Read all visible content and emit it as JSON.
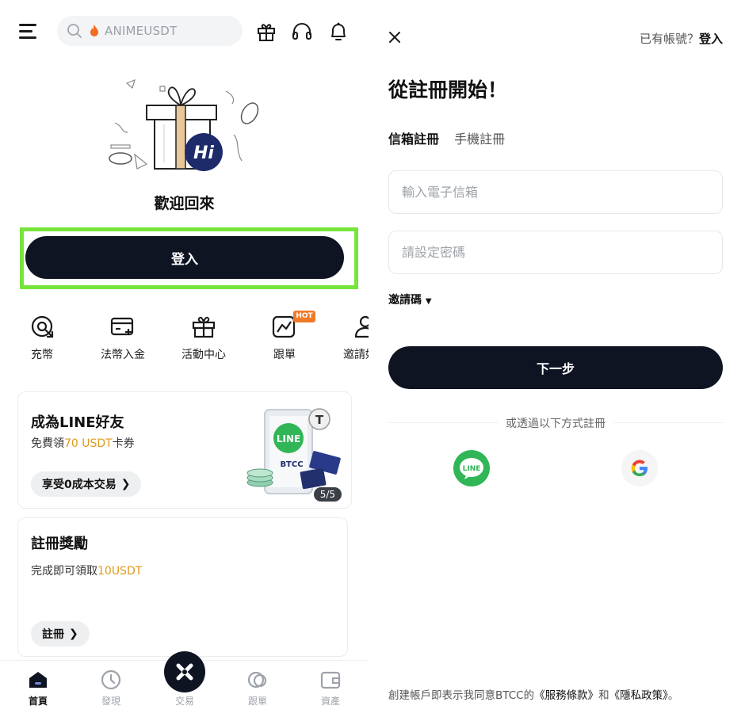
{
  "home": {
    "search": {
      "placeholder": "ANIMEUSDT"
    },
    "welcome_text": "歡迎回來",
    "login_label": "登入",
    "shortcuts": [
      {
        "label": "充幣",
        "icon": "deposit-icon"
      },
      {
        "label": "法幣入金",
        "icon": "fiat-card-icon"
      },
      {
        "label": "活動中心",
        "icon": "gift-icon"
      },
      {
        "label": "跟單",
        "icon": "copy-trade-chart-icon",
        "badge": "HOT"
      },
      {
        "label": "邀請好友",
        "icon": "invite-user-icon"
      }
    ],
    "promo_card": {
      "title": "成為LINE好友",
      "subtitle_prefix": "免費領",
      "subtitle_accent": "70 USDT",
      "subtitle_suffix": "卡券",
      "button": "享受0成本交易",
      "page_indicator": "5/5",
      "illustration_text": "LINE",
      "illustration_brand": "BTCC"
    },
    "reward_card": {
      "title": "註冊獎勵",
      "subtitle_prefix": "完成即可領取",
      "subtitle_accent": "10USDT",
      "button": "註冊"
    },
    "bottom_nav": [
      {
        "label": "首頁",
        "icon": "home-icon",
        "active": true
      },
      {
        "label": "發現",
        "icon": "discover-icon",
        "active": false
      },
      {
        "label": "交易",
        "icon": "trade-icon",
        "active": false
      },
      {
        "label": "跟單",
        "icon": "copy-trade-icon",
        "active": false
      },
      {
        "label": "資產",
        "icon": "wallet-icon",
        "active": false
      }
    ],
    "highlight_color": "#76e43a",
    "accent_color": "#e09a1b",
    "primary_color": "#0f1423"
  },
  "register": {
    "has_account_prefix": "已有帳號？",
    "has_account_link": "登入",
    "title": "從註冊開始！",
    "tabs": [
      {
        "label": "信箱註冊",
        "active": true
      },
      {
        "label": "手機註冊",
        "active": false
      }
    ],
    "email_placeholder": "輸入電子信箱",
    "password_placeholder": "請設定密碼",
    "invite_label": "邀請碼",
    "next_label": "下一步",
    "or_text": "或透過以下方式註冊",
    "social": [
      {
        "name": "LINE",
        "icon": "line-icon",
        "color": "#30b656"
      },
      {
        "name": "Google",
        "icon": "google-icon"
      }
    ],
    "terms_prefix": "創建帳戶即表示我同意BTCC的",
    "terms_link": "《服務條款》",
    "terms_and": "和",
    "privacy_link": "《隱私政策》",
    "terms_suffix": "。"
  }
}
